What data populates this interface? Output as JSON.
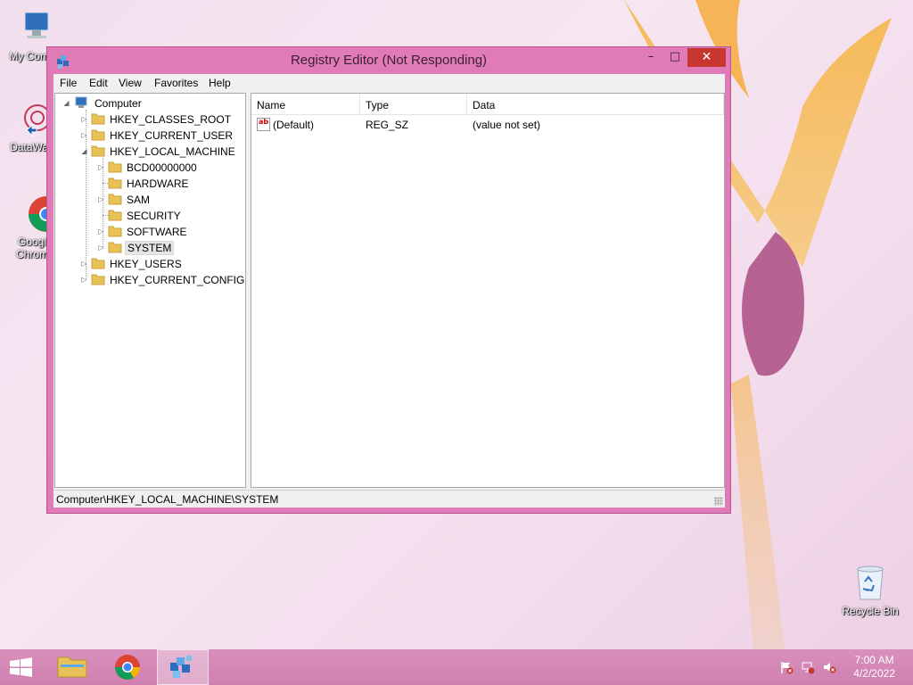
{
  "desktop": {
    "icons": [
      {
        "label": "My Comp"
      },
      {
        "label": "DataWag"
      },
      {
        "label": "Googl",
        "label2": "Chrom"
      },
      {
        "label": "Recycle Bin"
      }
    ]
  },
  "window": {
    "title": "Registry Editor (Not Responding)",
    "controls": {
      "minimize": "–",
      "maximize": "□",
      "close": "✕"
    },
    "menu": [
      "File",
      "Edit",
      "View",
      "Favorites",
      "Help"
    ]
  },
  "tree": {
    "root": "Computer",
    "hives": [
      {
        "label": "HKEY_CLASSES_ROOT",
        "expander": "▷"
      },
      {
        "label": "HKEY_CURRENT_USER",
        "expander": "▷"
      },
      {
        "label": "HKEY_LOCAL_MACHINE",
        "expander": "◢"
      },
      {
        "label": "HKEY_USERS",
        "expander": "▷"
      },
      {
        "label": "HKEY_CURRENT_CONFIG",
        "expander": "▷"
      }
    ],
    "hklm_children": [
      {
        "label": "BCD00000000",
        "expander": "▷"
      },
      {
        "label": "HARDWARE",
        "expander": ""
      },
      {
        "label": "SAM",
        "expander": "▷"
      },
      {
        "label": "SECURITY",
        "expander": ""
      },
      {
        "label": "SOFTWARE",
        "expander": "▷"
      },
      {
        "label": "SYSTEM",
        "expander": "▷",
        "selected": true
      }
    ]
  },
  "listview": {
    "columns": [
      "Name",
      "Type",
      "Data"
    ],
    "rows": [
      {
        "name": "(Default)",
        "type": "REG_SZ",
        "data": "(value not set)",
        "icon": "ab"
      }
    ]
  },
  "status": {
    "path": "Computer\\HKEY_LOCAL_MACHINE\\SYSTEM"
  },
  "taskbar": {
    "items": [
      "start-icon",
      "file-explorer-icon",
      "chrome-icon",
      "registry-editor-icon"
    ],
    "clock": {
      "time": "7:00 AM",
      "date": "4/2/2022"
    }
  },
  "colors": {
    "accent": "#e07bb7",
    "close": "#c7372f",
    "taskbar": "#d98fbc"
  }
}
